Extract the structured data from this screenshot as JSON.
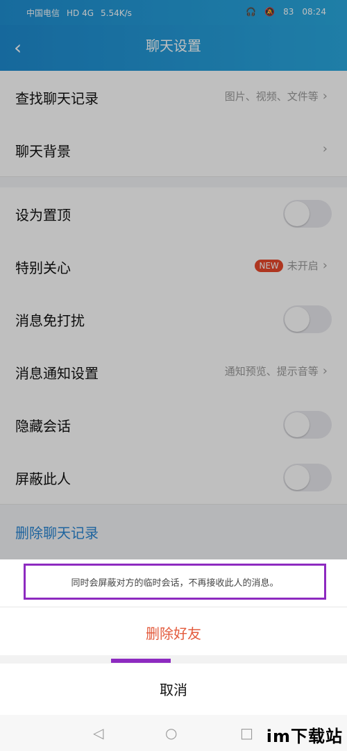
{
  "status": {
    "carrier": "中国电信",
    "network": "HD 4G",
    "speed": "5.54K/s",
    "battery": "83",
    "time": "08:24"
  },
  "navbar": {
    "title": "聊天设置"
  },
  "settings": [
    {
      "label": "查找聊天记录",
      "right": "图片、视频、文件等",
      "type": "link"
    },
    {
      "label": "聊天背景",
      "right": "",
      "type": "link"
    },
    {
      "label": "设为置顶",
      "type": "toggle"
    },
    {
      "label": "特别关心",
      "badge": "NEW",
      "right": "未开启",
      "type": "link"
    },
    {
      "label": "消息免打扰",
      "type": "toggle"
    },
    {
      "label": "消息通知设置",
      "right": "通知预览、提示音等",
      "type": "link"
    },
    {
      "label": "隐藏会话",
      "type": "toggle"
    },
    {
      "label": "屏蔽此人",
      "type": "toggle"
    }
  ],
  "delete_history": "删除聊天记录",
  "sheet": {
    "warning": "同时会屏蔽对方的临时会话，不再接收此人的消息。",
    "delete_friend": "删除好友",
    "cancel": "取消"
  },
  "system_nav": {
    "back": "◁",
    "home": "○",
    "recent": "□"
  },
  "watermark": "im下载站",
  "colors": {
    "accent": "#2aa8df",
    "danger": "#e35a3c",
    "highlight": "#8d2ac0",
    "link": "#2a86d3"
  }
}
